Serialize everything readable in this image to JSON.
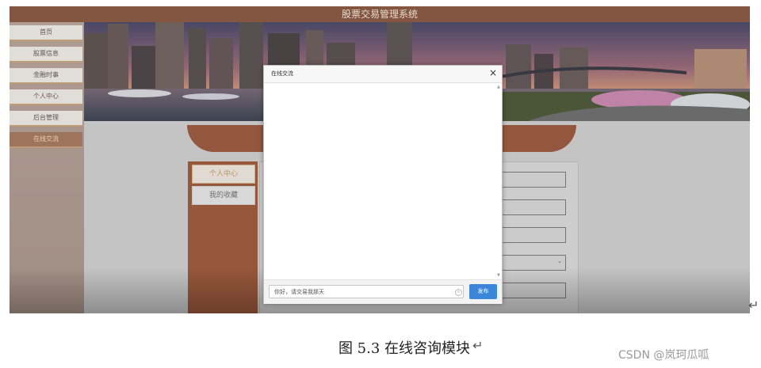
{
  "app": {
    "title": "股票交易管理系统"
  },
  "sidebar": {
    "items": [
      {
        "label": "首页"
      },
      {
        "label": "股票信息"
      },
      {
        "label": "金融时事"
      },
      {
        "label": "个人中心"
      },
      {
        "label": "后台管理"
      },
      {
        "label": "在线交流",
        "active": true
      }
    ]
  },
  "user_menu": {
    "items": [
      {
        "label": "个人中心",
        "active": true
      },
      {
        "label": "我的收藏"
      }
    ]
  },
  "modal": {
    "title": "在线交流",
    "close_icon": "close-icon",
    "input_value": "你好，请交易我那天",
    "send_label": "发布"
  },
  "document": {
    "caption": "图 5.3  在线咨询模块",
    "paragraph_mark": "↵",
    "watermark": "CSDN @岚珂瓜呱"
  },
  "colors": {
    "brand_brown": "#8b5a44",
    "accent_blue": "#3b86d9"
  }
}
